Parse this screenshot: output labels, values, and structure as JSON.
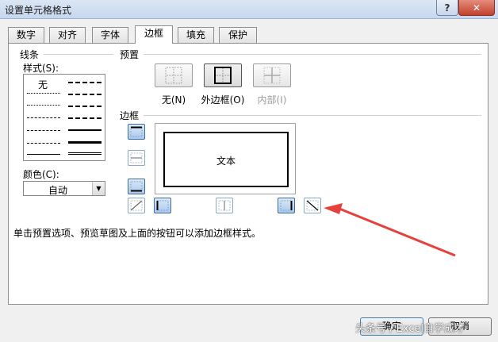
{
  "window": {
    "title": "设置单元格格式",
    "help_glyph": "?",
    "close_glyph": "✕"
  },
  "tabs": [
    {
      "label": "数字",
      "active": false
    },
    {
      "label": "对齐",
      "active": false
    },
    {
      "label": "字体",
      "active": false
    },
    {
      "label": "边框",
      "active": true
    },
    {
      "label": "填充",
      "active": false
    },
    {
      "label": "保护",
      "active": false
    }
  ],
  "line": {
    "section_label": "线条",
    "style_label": "样式(S):",
    "none_label": "无",
    "color_label": "颜色(C):",
    "color_value": "自动",
    "dropdown_icon": "triangle-down-icon"
  },
  "presets": {
    "section_label": "预置",
    "items": [
      {
        "label": "无(N)",
        "icon": "border-none-icon",
        "enabled": true,
        "pressed": false
      },
      {
        "label": "外边框(O)",
        "icon": "border-outline-icon",
        "enabled": true,
        "pressed": true
      },
      {
        "label": "内部(I)",
        "icon": "border-inside-icon",
        "enabled": false,
        "pressed": false
      }
    ]
  },
  "border": {
    "section_label": "边框",
    "preview_text": "文本",
    "buttons": [
      {
        "name": "border-top",
        "icon": "border-top-icon",
        "on": true
      },
      {
        "name": "border-inside-horizontal",
        "icon": "border-inside-horizontal-icon",
        "on": false
      },
      {
        "name": "border-bottom",
        "icon": "border-bottom-icon",
        "on": true
      },
      {
        "name": "border-diagonal-up",
        "icon": "diagonal-up-icon",
        "on": false
      },
      {
        "name": "border-left",
        "icon": "border-left-icon",
        "on": true
      },
      {
        "name": "border-inside-vertical",
        "icon": "border-inside-vertical-icon",
        "on": false
      },
      {
        "name": "border-right",
        "icon": "border-right-icon",
        "on": true
      },
      {
        "name": "border-diagonal-down",
        "icon": "diagonal-down-icon",
        "on": false
      }
    ]
  },
  "hint": "单击预置选项、预览草图及上面的按钮可以添加边框样式。",
  "buttons": {
    "ok": "确定",
    "cancel": "取消"
  },
  "annotation_color": "#e8403a",
  "watermark": "头条号 / Excel自学成才"
}
